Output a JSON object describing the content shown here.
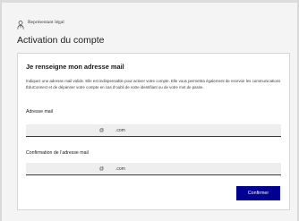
{
  "header": {
    "role_icon": "user-tie-icon",
    "role_label": "Représentant légal"
  },
  "page": {
    "title": "Activation du compte"
  },
  "form": {
    "heading": "Je renseigne mon adresse mail",
    "description": "Indiquez une adresse mail valide. Elle est indispensable pour activer votre compte. Elle vous permettra également de recevoir les communications ÉduConnect et de dépanner votre compte en cas d’oubli de votre identifiant ou de votre mot de passe.",
    "email": {
      "label": "Adresse mail",
      "at": "@",
      "domain": ".com"
    },
    "confirm_email": {
      "label": "Confirmation de l’adresse mail",
      "at": "@",
      "domain": ".com"
    },
    "submit_label": "Confirmer"
  },
  "colors": {
    "primary_button": "#000091",
    "background": "#f4f4f4",
    "card": "#ffffff"
  }
}
